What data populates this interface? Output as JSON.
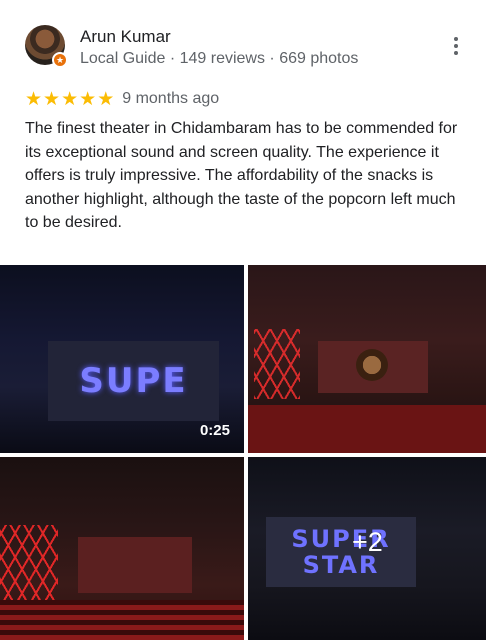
{
  "reviewer": {
    "name": "Arun Kumar",
    "meta": "Local Guide · 149 reviews · 669 photos"
  },
  "rating": {
    "stars": 5,
    "date": "9 months ago",
    "star_color": "#fbbc04"
  },
  "review_text": "The finest theater in Chidambaram has to be commended for its exceptional sound and screen quality. The experience it offers is truly impressive. The affordability of the snacks is another highlight, although the taste of the popcorn left much to be desired.",
  "photos": {
    "video_duration": "0:25",
    "screen1_text": "SUPE",
    "screen4_line1": "SUPER",
    "screen4_line2": "STAR",
    "more_count": "+2"
  },
  "icons": {
    "more": "more-vert-icon",
    "star": "star-icon",
    "guide_badge": "local-guide-badge-icon"
  }
}
